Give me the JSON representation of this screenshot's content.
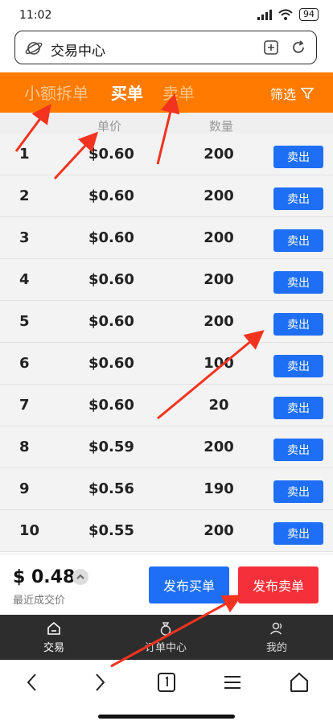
{
  "status_bar": {
    "time": "11:02",
    "battery": "94"
  },
  "url_bar": {
    "text": "交易中心"
  },
  "tabs": {
    "small": "小额拆单",
    "buy": "买单",
    "sell": "卖单",
    "filter": "筛选"
  },
  "table": {
    "headers": {
      "price": "单价",
      "quantity": "数量"
    },
    "action_label": "卖出",
    "rows": [
      {
        "index": "1",
        "price": "$0.60",
        "quantity": "200"
      },
      {
        "index": "2",
        "price": "$0.60",
        "quantity": "200"
      },
      {
        "index": "3",
        "price": "$0.60",
        "quantity": "200"
      },
      {
        "index": "4",
        "price": "$0.60",
        "quantity": "200"
      },
      {
        "index": "5",
        "price": "$0.60",
        "quantity": "200"
      },
      {
        "index": "6",
        "price": "$0.60",
        "quantity": "100"
      },
      {
        "index": "7",
        "price": "$0.60",
        "quantity": "20"
      },
      {
        "index": "8",
        "price": "$0.59",
        "quantity": "200"
      },
      {
        "index": "9",
        "price": "$0.56",
        "quantity": "190"
      },
      {
        "index": "10",
        "price": "$0.55",
        "quantity": "200"
      }
    ]
  },
  "bottom": {
    "last_price": "$ 0.48",
    "last_price_label": "最近成交价",
    "publish_buy": "发布买单",
    "publish_sell": "发布卖单"
  },
  "app_nav": {
    "trade": "交易",
    "orders": "订单中心",
    "mine": "我的"
  },
  "colors": {
    "accent": "#ff7a00",
    "button_blue": "#1e6ff5",
    "button_red": "#f5303a",
    "arrow_red": "#f2331f"
  }
}
